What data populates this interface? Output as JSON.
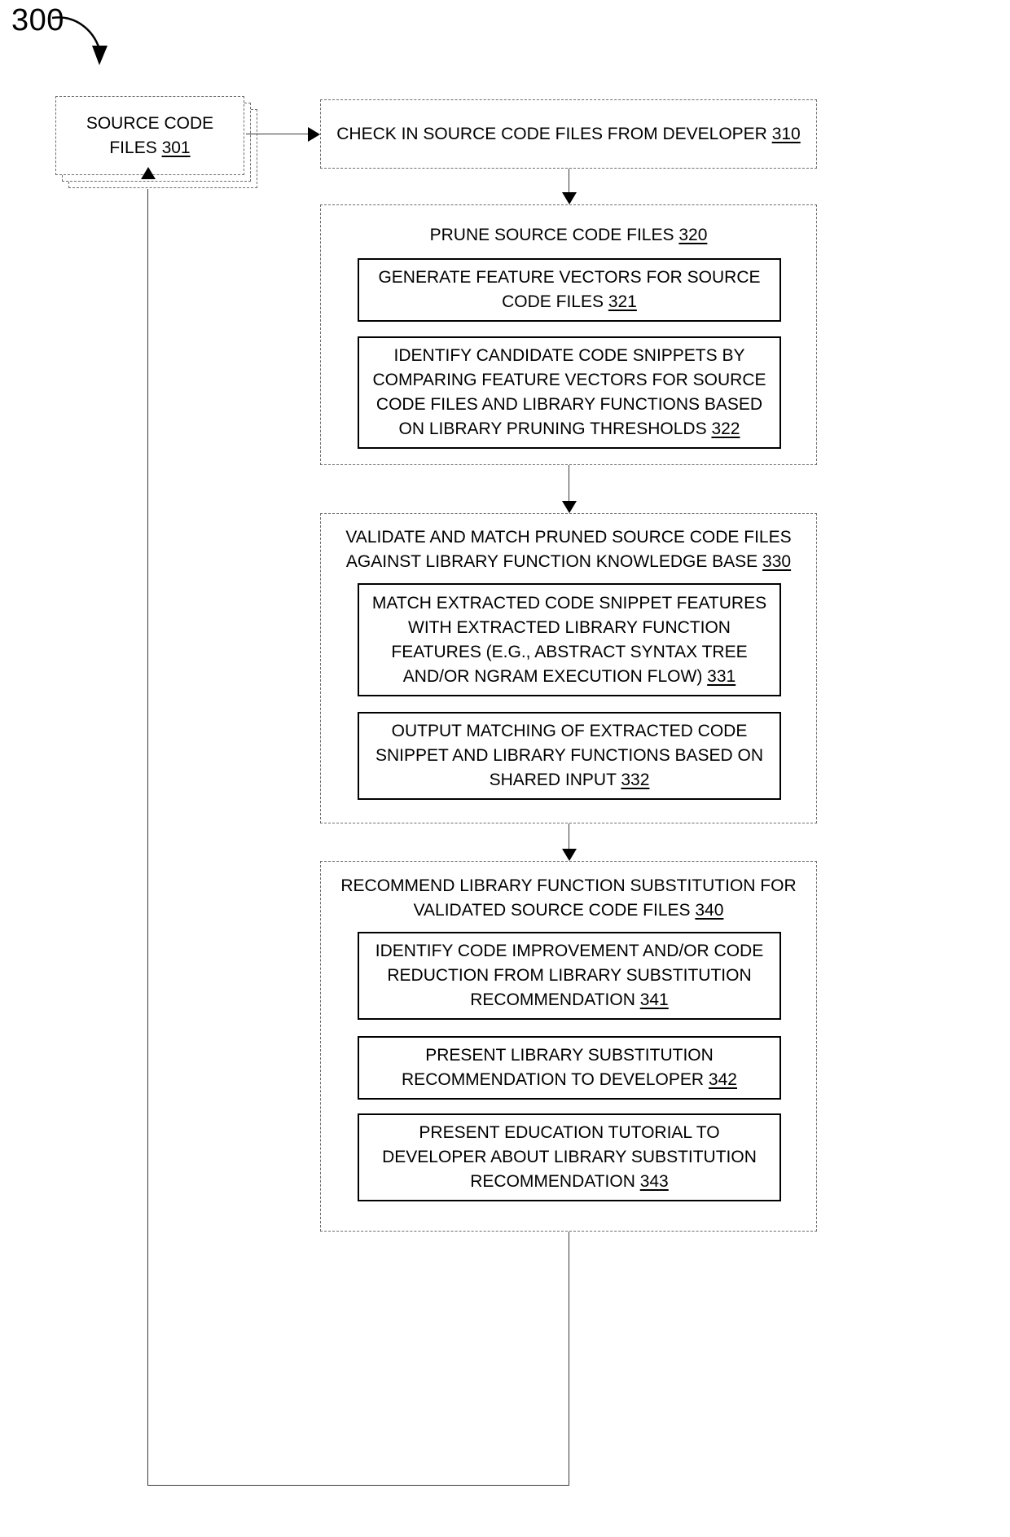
{
  "figure": {
    "number": "300",
    "lead_arrow_icon": "curved-arrow-icon"
  },
  "source_files": {
    "line1": "SOURCE CODE",
    "line2_text": "FILES ",
    "ref": "301"
  },
  "steps": [
    {
      "id": "step-310",
      "title_text": "CHECK IN SOURCE CODE FILES FROM DEVELOPER ",
      "ref": "310",
      "children": []
    },
    {
      "id": "step-320",
      "title_text": "PRUNE SOURCE CODE FILES ",
      "ref": "320",
      "children": [
        {
          "id": "step-321",
          "text": "GENERATE FEATURE VECTORS FOR SOURCE CODE FILES ",
          "ref": "321"
        },
        {
          "id": "step-322",
          "text": "IDENTIFY CANDIDATE CODE SNIPPETS BY COMPARING FEATURE VECTORS FOR SOURCE CODE FILES AND LIBRARY FUNCTIONS BASED ON LIBRARY PRUNING THRESHOLDS ",
          "ref": "322"
        }
      ]
    },
    {
      "id": "step-330",
      "title_text": "VALIDATE AND MATCH PRUNED SOURCE CODE FILES AGAINST LIBRARY FUNCTION KNOWLEDGE BASE ",
      "ref": "330",
      "children": [
        {
          "id": "step-331",
          "text": "MATCH EXTRACTED CODE SNIPPET FEATURES WITH EXTRACTED LIBRARY FUNCTION FEATURES (E.G., ABSTRACT SYNTAX TREE AND/OR NGRAM EXECUTION FLOW) ",
          "ref": "331"
        },
        {
          "id": "step-332",
          "text": "OUTPUT MATCHING OF EXTRACTED CODE SNIPPET AND LIBRARY FUNCTIONS BASED ON SHARED INPUT ",
          "ref": "332"
        }
      ]
    },
    {
      "id": "step-340",
      "title_text": "RECOMMEND LIBRARY FUNCTION SUBSTITUTION FOR VALIDATED SOURCE CODE FILES ",
      "ref": "340",
      "children": [
        {
          "id": "step-341",
          "text": "IDENTIFY CODE IMPROVEMENT AND/OR CODE REDUCTION FROM LIBRARY SUBSTITUTION RECOMMENDATION ",
          "ref": "341"
        },
        {
          "id": "step-342",
          "text": "PRESENT LIBRARY SUBSTITUTION RECOMMENDATION TO DEVELOPER ",
          "ref": "342"
        },
        {
          "id": "step-343",
          "text": "PRESENT EDUCATION TUTORIAL TO DEVELOPER ABOUT LIBRARY SUBSTITUTION RECOMMENDATION ",
          "ref": "343"
        }
      ]
    }
  ],
  "colors": {
    "line": "#3a3a3a",
    "dashed_border": "#6d6d6d",
    "solid_border": "#000000",
    "text": "#000000",
    "background": "#ffffff"
  }
}
